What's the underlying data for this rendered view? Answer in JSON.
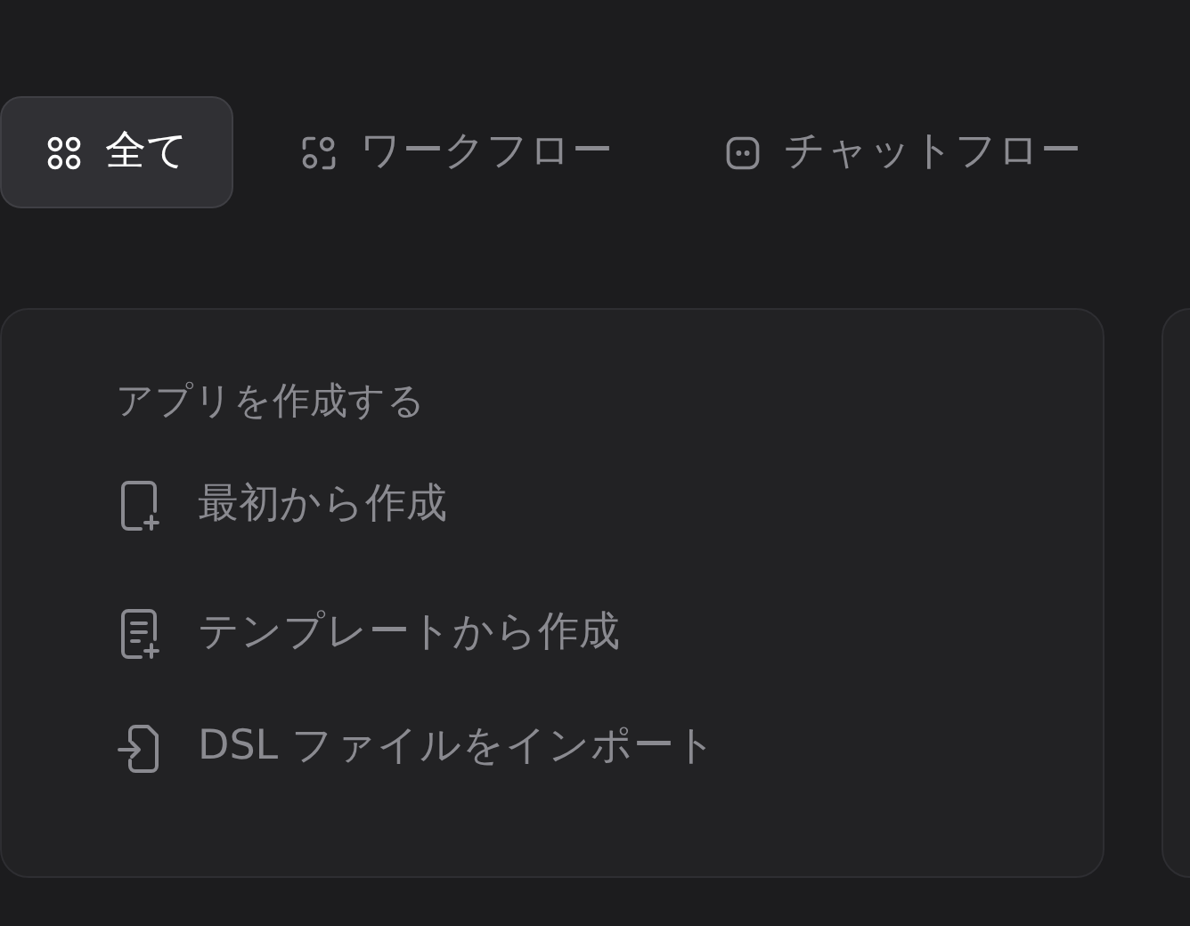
{
  "tabs": [
    {
      "label": "全て",
      "selected": true
    },
    {
      "label": "ワークフロー",
      "selected": false
    },
    {
      "label": "チャットフロー",
      "selected": false
    }
  ],
  "create_card": {
    "title": "アプリを作成する",
    "items": [
      {
        "label": "最初から作成"
      },
      {
        "label": "テンプレートから作成"
      },
      {
        "label": "DSL ファイルをインポート"
      }
    ]
  }
}
